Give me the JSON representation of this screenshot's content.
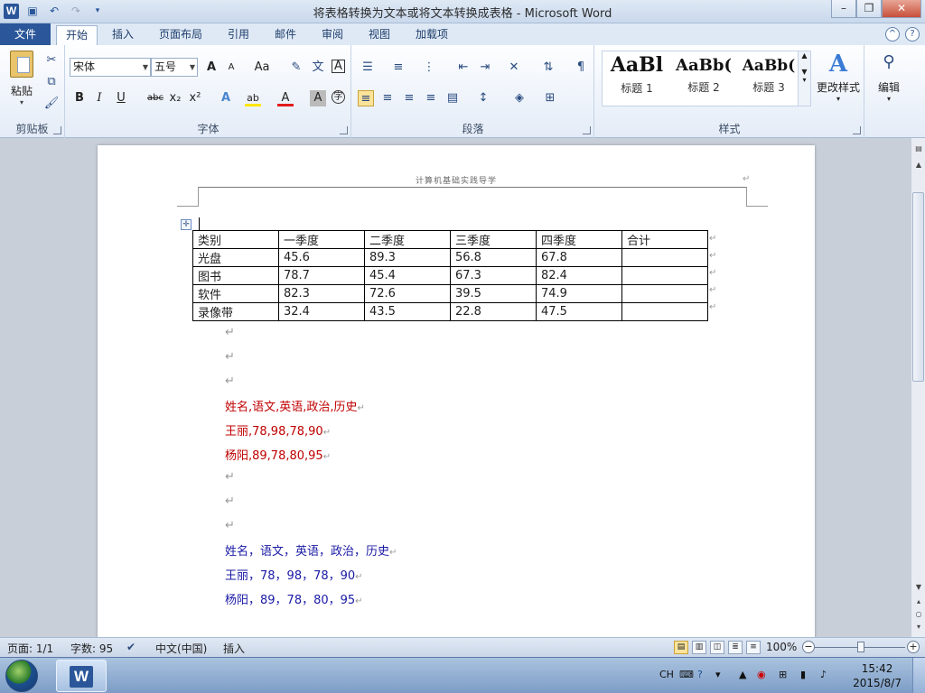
{
  "window": {
    "title": "将表格转换为文本或将文本转换成表格 - Microsoft Word",
    "app_letter": "W",
    "minimize": "–",
    "maximize": "❐",
    "close": "✕"
  },
  "ribbon_tabs": [
    "文件",
    "开始",
    "插入",
    "页面布局",
    "引用",
    "邮件",
    "审阅",
    "视图",
    "加载项"
  ],
  "ribbon": {
    "clipboard": {
      "label": "剪贴板",
      "paste": "粘贴"
    },
    "font": {
      "label": "字体",
      "font_name": "宋体",
      "font_size": "五号",
      "grow": "A",
      "shrink": "A",
      "case": "Aa",
      "bold": "B",
      "italic": "I",
      "underline": "U",
      "strike": "abc",
      "subscript": "x₂",
      "superscript": "x²",
      "effects": "A",
      "highlight": "ab",
      "color": "A",
      "shade": "A",
      "wen": "文",
      "char_border": "A",
      "enclose": "字"
    },
    "paragraph": {
      "label": "段落"
    },
    "styles": {
      "label": "样式",
      "items": [
        {
          "sample": "AaBl",
          "name": "标题 1"
        },
        {
          "sample": "AaBb(",
          "name": "标题 2"
        },
        {
          "sample": "AaBb(",
          "name": "标题 3"
        }
      ],
      "change_styles": "更改样式"
    },
    "editing": {
      "label": "编辑"
    }
  },
  "document": {
    "header_text": "计算机基础实践导学",
    "table": {
      "headers": [
        "类别",
        "一季度",
        "二季度",
        "三季度",
        "四季度",
        "合计"
      ],
      "rows": [
        [
          "光盘",
          "45.6",
          "89.3",
          "56.8",
          "67.8",
          ""
        ],
        [
          "图书",
          "78.7",
          "45.4",
          "67.3",
          "82.4",
          ""
        ],
        [
          "软件",
          "82.3",
          "72.6",
          "39.5",
          "74.9",
          ""
        ],
        [
          "录像带",
          "32.4",
          "43.5",
          "22.8",
          "47.5",
          ""
        ]
      ]
    },
    "para_mark": "↵",
    "red_lines": [
      "姓名,语文,英语,政治,历史",
      "王丽,78,98,78,90",
      "杨阳,89,78,80,95"
    ],
    "blue_lines": [
      "姓名，语文，英语，政治，历史",
      "王丽，78，98，78，90",
      "杨阳，89，78，80，95"
    ]
  },
  "statusbar": {
    "page": "页面: 1/1",
    "words": "字数: 95",
    "language": "中文(中国)",
    "insert_mode": "插入",
    "zoom": "100%"
  },
  "taskbar": {
    "ime": "CH",
    "time": "15:42",
    "date": "2015/8/7"
  }
}
